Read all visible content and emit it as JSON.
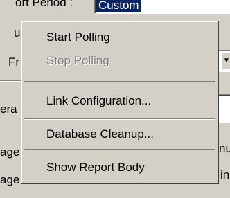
{
  "background": {
    "report_period_label": "ort Period :",
    "report_period_value": "Custom",
    "frag_1": "ust",
    "frag_2": "Fr",
    "frag_3": "era",
    "frag_4": "age",
    "frag_5": "age",
    "frag_6": "nu",
    "frag_7": "in",
    "dropdown_arrow": "▼"
  },
  "menu": {
    "items": [
      {
        "label": "Start Polling",
        "enabled": true
      },
      {
        "label": "Stop Polling",
        "enabled": false
      },
      {
        "label": "Link Configuration...",
        "enabled": true
      },
      {
        "label": "Database Cleanup...",
        "enabled": true
      },
      {
        "label": "Show Report Body",
        "enabled": true
      }
    ]
  },
  "colors": {
    "face": "#d4d0c8",
    "selection": "#0a246a",
    "disabled_text": "#808080"
  }
}
